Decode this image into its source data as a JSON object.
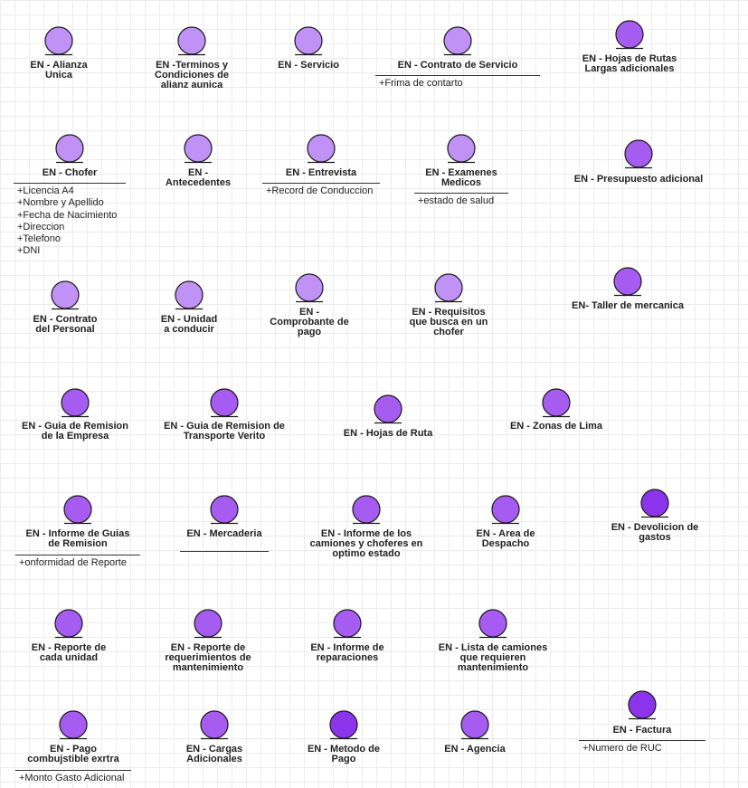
{
  "diagram": {
    "entities": [
      {
        "id": "alianza",
        "name": "EN - Alianza\nUnica",
        "color": "#c092f5",
        "attributes": []
      },
      {
        "id": "terminos",
        "name": "EN -Terminos y\nCondiciones de\nalianz aunica",
        "color": "#c092f5",
        "attributes": []
      },
      {
        "id": "servicio",
        "name": "EN - Servicio",
        "color": "#c092f5",
        "attributes": []
      },
      {
        "id": "contrato-servicio",
        "name": "EN - Contrato de Servicio",
        "color": "#c092f5",
        "attributes": [
          "+Frima de contarto"
        ]
      },
      {
        "id": "hojas-rutas-largas",
        "name": "EN - Hojas de Rutas\nLargas adicionales",
        "color": "#a65cf0",
        "attributes": []
      },
      {
        "id": "chofer",
        "name": "EN - Chofer",
        "color": "#c092f5",
        "attributes": [
          "+Licencia A4",
          "+Nombre y Apellido",
          "+Fecha de Nacimiento",
          "+Direccion",
          "+Telefono",
          "+DNI"
        ]
      },
      {
        "id": "antecedentes",
        "name": "EN -\nAntecedentes",
        "color": "#c092f5",
        "attributes": []
      },
      {
        "id": "entrevista",
        "name": "EN -  Entrevista",
        "color": "#c092f5",
        "attributes": [
          "+Record de Conduccion"
        ]
      },
      {
        "id": "examenes",
        "name": "EN - Examenes\nMedicos",
        "color": "#c092f5",
        "attributes": [
          "+estado de salud"
        ]
      },
      {
        "id": "presupuesto",
        "name": "EN - Presupuesto adicional",
        "color": "#a65cf0",
        "attributes": []
      },
      {
        "id": "contrato-personal",
        "name": "EN - Contrato\ndel Personal",
        "color": "#c092f5",
        "attributes": []
      },
      {
        "id": "unidad",
        "name": "EN - Unidad\na conducir",
        "color": "#c092f5",
        "attributes": []
      },
      {
        "id": "comprobante",
        "name": "EN -\nComprobante de\npago",
        "color": "#c092f5",
        "attributes": []
      },
      {
        "id": "requisitos",
        "name": "EN - Requisitos\nque busca en un\nchofer",
        "color": "#c092f5",
        "attributes": []
      },
      {
        "id": "taller",
        "name": "EN- Taller de mercanica",
        "color": "#a65cf0",
        "attributes": []
      },
      {
        "id": "guia-empresa",
        "name": "EN - Guia de Remision\nde la Empresa",
        "color": "#a65cf0",
        "attributes": []
      },
      {
        "id": "guia-verito",
        "name": "EN - Guia de Remision de\nTransporte Verito",
        "color": "#a65cf0",
        "attributes": []
      },
      {
        "id": "hojas-ruta",
        "name": "EN - Hojas de Ruta",
        "color": "#a65cf0",
        "attributes": []
      },
      {
        "id": "zonas-lima",
        "name": "EN - Zonas de Lima",
        "color": "#a65cf0",
        "attributes": []
      },
      {
        "id": "informe-guias",
        "name": "EN - Informe de Guias\nde Remision",
        "color": "#a65cf0",
        "attributes": [
          "+onformidad de Reporte"
        ]
      },
      {
        "id": "mercaderia",
        "name": "EN -  Mercaderia",
        "color": "#a65cf0",
        "attributes": []
      },
      {
        "id": "informe-camiones",
        "name": "EN - Informe de los\ncamiones y choferes en\noptimo estado",
        "color": "#a65cf0",
        "attributes": []
      },
      {
        "id": "area-despacho",
        "name": "EN - Area de\nDespacho",
        "color": "#a65cf0",
        "attributes": []
      },
      {
        "id": "devolucion",
        "name": "EN - Devolicion de\ngastos",
        "color": "#8c34ec",
        "attributes": []
      },
      {
        "id": "reporte-unidad",
        "name": "EN - Reporte de\ncada unidad",
        "color": "#a65cf0",
        "attributes": []
      },
      {
        "id": "reporte-requerimientos",
        "name": "EN - Reporte de\nrequerimientos de\nmantenimiento",
        "color": "#a65cf0",
        "attributes": []
      },
      {
        "id": "informe-reparaciones",
        "name": "EN - Informe de\nreparaciones",
        "color": "#a65cf0",
        "attributes": []
      },
      {
        "id": "lista-camiones",
        "name": "EN -  Lista de camiones\nque requieren\nmantenimiento",
        "color": "#a65cf0",
        "attributes": []
      },
      {
        "id": "pago-combustible",
        "name": "EN - Pago\ncombujstible  exrtra",
        "color": "#a65cf0",
        "attributes": [
          "+Monto Gasto Adicional"
        ]
      },
      {
        "id": "cargas",
        "name": "EN - Cargas\nAdicionales",
        "color": "#a65cf0",
        "attributes": []
      },
      {
        "id": "metodo-pago",
        "name": "EN -  Metodo de\nPago",
        "color": "#8c34ec",
        "attributes": []
      },
      {
        "id": "agencia",
        "name": "EN - Agencia",
        "color": "#a65cf0",
        "attributes": []
      },
      {
        "id": "factura",
        "name": "EN - Factura",
        "color": "#8c34ec",
        "attributes": [
          "+Numero de RUC"
        ]
      }
    ]
  }
}
